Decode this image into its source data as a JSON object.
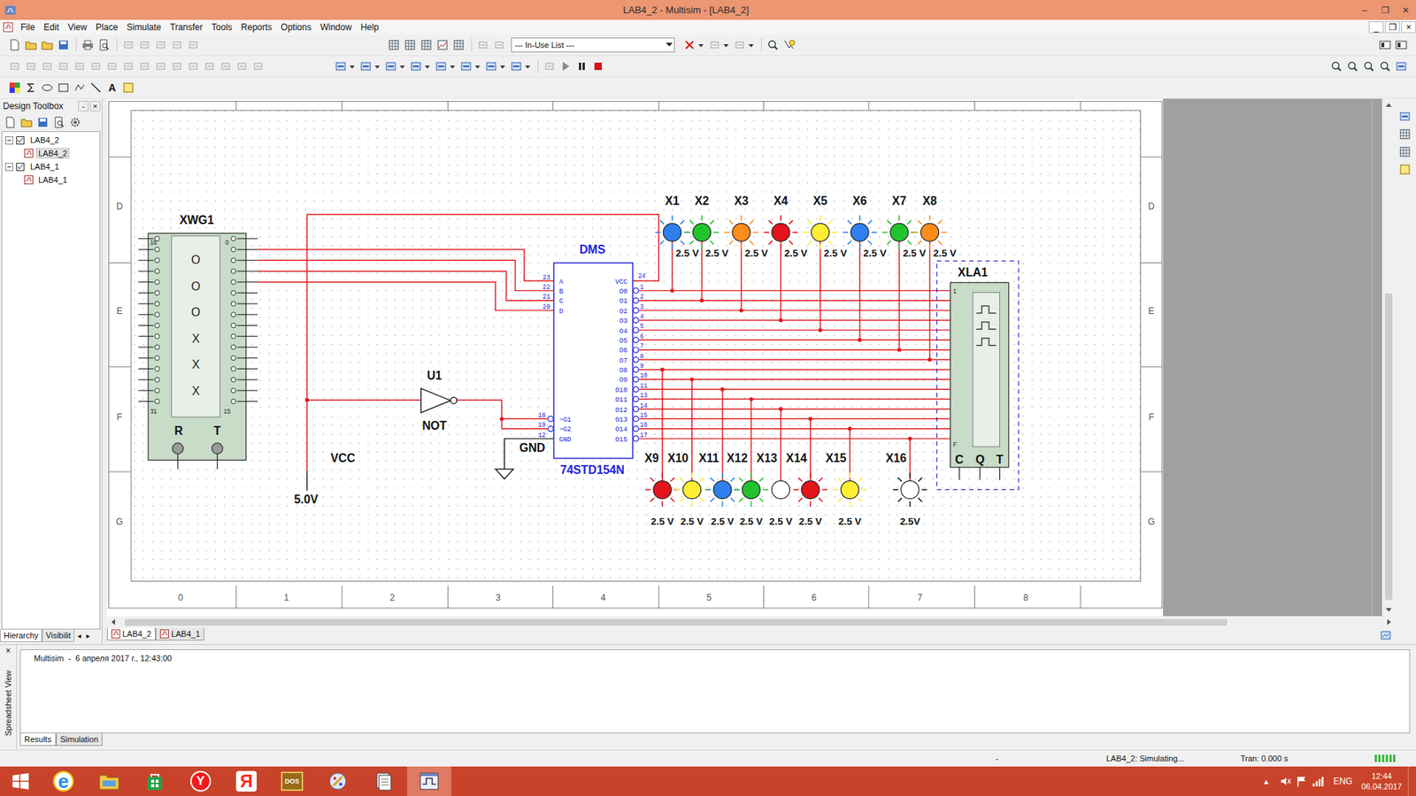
{
  "window": {
    "title": "LAB4_2 - Multisim - [LAB4_2]",
    "controls": [
      "–",
      "❐",
      "✕"
    ]
  },
  "menu": {
    "items": [
      "File",
      "Edit",
      "View",
      "Place",
      "Simulate",
      "Transfer",
      "Tools",
      "Reports",
      "Options",
      "Window",
      "Help"
    ],
    "doc_controls": [
      "_",
      "❐",
      "×"
    ]
  },
  "toolbar": {
    "in_use_list": "--- In-Use List ---",
    "text_tool": "A"
  },
  "design_toolbox": {
    "title": "Design Toolbox",
    "controls": [
      "-",
      "×"
    ],
    "tree": [
      {
        "label": "LAB4_2",
        "depth": 0,
        "expanded": true,
        "selected": false
      },
      {
        "label": "LAB4_2",
        "depth": 1,
        "expanded": false,
        "selected": true
      },
      {
        "label": "LAB4_1",
        "depth": 0,
        "expanded": true,
        "selected": false
      },
      {
        "label": "LAB4_1",
        "depth": 1,
        "expanded": false,
        "selected": false
      }
    ],
    "tabs": [
      {
        "label": "Hierarchy",
        "selected": true
      },
      {
        "label": "Visibilit",
        "selected": false
      }
    ],
    "tab_arrows": [
      "◂",
      "▸"
    ]
  },
  "schematic": {
    "ruler": {
      "rows": [
        "D",
        "E",
        "F",
        "G"
      ],
      "cols": [
        "0",
        "1",
        "2",
        "3",
        "4",
        "5",
        "6",
        "7",
        "8"
      ]
    },
    "generator": {
      "ref": "XWG1",
      "display": [
        "O",
        "O",
        "O",
        "X",
        "X",
        "X"
      ],
      "corner_pins": [
        "16",
        "0",
        "31",
        "15"
      ],
      "terminals": [
        "R",
        "T"
      ]
    },
    "decoder": {
      "ref": "DMS",
      "part": "74STD154N",
      "vcc": {
        "name": "VCC",
        "pin": "24"
      },
      "inputs": [
        {
          "name": "A",
          "pin": "23"
        },
        {
          "name": "B",
          "pin": "22"
        },
        {
          "name": "C",
          "pin": "21"
        },
        {
          "name": "D",
          "pin": "20"
        }
      ],
      "controls": [
        {
          "name": "~G1",
          "pin": "18"
        },
        {
          "name": "~G2",
          "pin": "19"
        },
        {
          "name": "GND",
          "pin": "12"
        }
      ],
      "outputs": [
        {
          "name": "O0",
          "pin": "1"
        },
        {
          "name": "O1",
          "pin": "2"
        },
        {
          "name": "O2",
          "pin": "3"
        },
        {
          "name": "O3",
          "pin": "4"
        },
        {
          "name": "O4",
          "pin": "5"
        },
        {
          "name": "O5",
          "pin": "6"
        },
        {
          "name": "O6",
          "pin": "7"
        },
        {
          "name": "O7",
          "pin": "8"
        },
        {
          "name": "O8",
          "pin": "9"
        },
        {
          "name": "O9",
          "pin": "10"
        },
        {
          "name": "O10",
          "pin": "11"
        },
        {
          "name": "O11",
          "pin": "13"
        },
        {
          "name": "O12",
          "pin": "14"
        },
        {
          "name": "O13",
          "pin": "15"
        },
        {
          "name": "O14",
          "pin": "16"
        },
        {
          "name": "O15",
          "pin": "17"
        }
      ]
    },
    "inverter": {
      "ref": "U1",
      "type": "NOT"
    },
    "supply": {
      "name": "VCC",
      "value": "5.0V"
    },
    "ground": {
      "name": "GND"
    },
    "analyzer": {
      "ref": "XLA1",
      "first_pin": "1",
      "last_pin": "F",
      "terminals": [
        "C",
        "Q",
        "T"
      ]
    },
    "leds": [
      {
        "name": "X1",
        "reading": "2.5 V",
        "color": "#2f80ed",
        "on": true
      },
      {
        "name": "X2",
        "reading": "2.5 V",
        "color": "#22c32e",
        "on": true
      },
      {
        "name": "X3",
        "reading": "2.5 V",
        "color": "#ff8c1a",
        "on": true
      },
      {
        "name": "X4",
        "reading": "2.5 V",
        "color": "#e4141b",
        "on": true
      },
      {
        "name": "X5",
        "reading": "2.5 V",
        "color": "#ffee33",
        "on": true
      },
      {
        "name": "X6",
        "reading": "2.5 V",
        "color": "#2f80ed",
        "on": true
      },
      {
        "name": "X7",
        "reading": "2.5 V",
        "color": "#22c32e",
        "on": true
      },
      {
        "name": "X8",
        "reading": "2.5 V",
        "color": "#ff8c1a",
        "on": true
      },
      {
        "name": "X9",
        "reading": "2.5 V",
        "color": "#e4141b",
        "on": true
      },
      {
        "name": "X10",
        "reading": "2.5 V",
        "color": "#ffee33",
        "on": true
      },
      {
        "name": "X11",
        "reading": "2.5 V",
        "color": "#2f80ed",
        "on": true
      },
      {
        "name": "X12",
        "reading": "2.5 V",
        "color": "#22c32e",
        "on": true
      },
      {
        "name": "X13",
        "reading": "2.5 V",
        "color": "#ffffff",
        "on": false
      },
      {
        "name": "X14",
        "reading": "2.5 V",
        "color": "#e4141b",
        "on": true
      },
      {
        "name": "X15",
        "reading": "2.5 V",
        "color": "#ffee33",
        "on": true
      },
      {
        "name": "X16",
        "reading": "2.5V",
        "color": "#ffffff",
        "on": true
      }
    ]
  },
  "sheet_tabs": [
    {
      "label": "LAB4_2",
      "selected": true
    },
    {
      "label": "LAB4_1",
      "selected": false
    }
  ],
  "spreadsheet": {
    "title": "Spreadsheet View",
    "close": "×",
    "log": "Multisim  -  6 апреля 2017 г., 12:43:00",
    "tabs": [
      {
        "label": "Results",
        "selected": true
      },
      {
        "label": "Simulation",
        "selected": false
      }
    ]
  },
  "status_bar": {
    "left": "-",
    "middle": "LAB4_2: Simulating...",
    "right": "Tran: 0.000 s"
  },
  "taskbar": {
    "apps": [
      {
        "kind": "ie",
        "glyph": "e",
        "selected": false
      },
      {
        "kind": "explorer",
        "selected": false
      },
      {
        "kind": "store",
        "selected": false
      },
      {
        "kind": "yandex",
        "glyph": "Y",
        "selected": false
      },
      {
        "kind": "yabrowser",
        "glyph": "Я",
        "selected": false
      },
      {
        "kind": "dosbox",
        "glyph": "DOS",
        "selected": false
      },
      {
        "kind": "paint",
        "selected": false
      },
      {
        "kind": "files",
        "selected": false
      },
      {
        "kind": "multisim",
        "selected": true
      }
    ],
    "tray_arrow": "▲",
    "lang": "ENG",
    "time": "12:44",
    "date": "06.04.2017"
  }
}
